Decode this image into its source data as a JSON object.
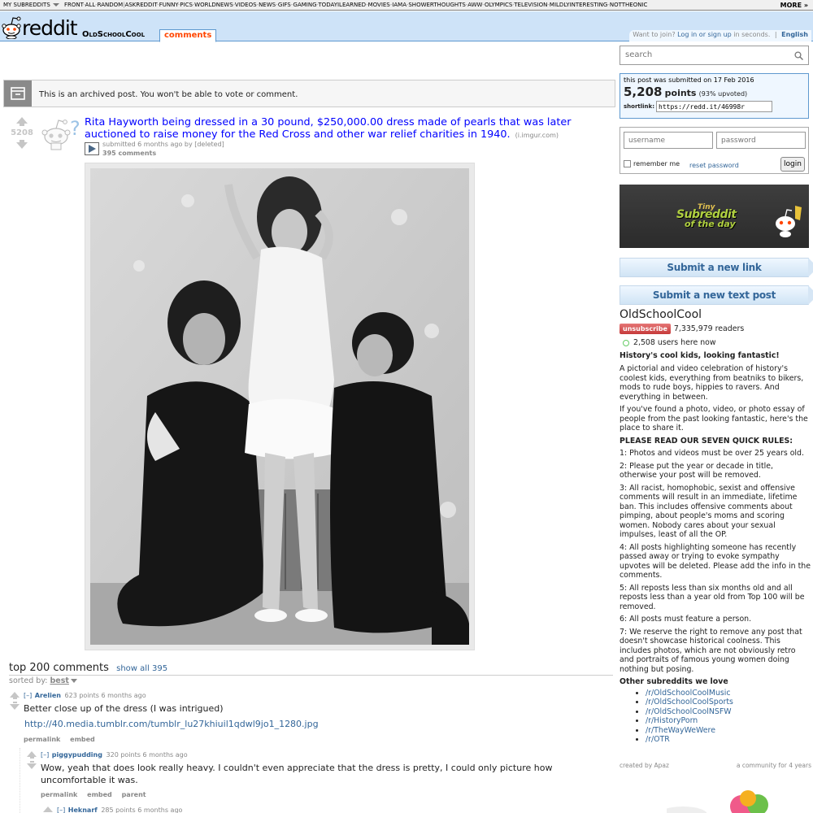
{
  "strip": {
    "my_subreddits": "MY SUBREDDITS",
    "links": [
      "FRONT",
      "ALL",
      "RANDOM",
      "ASKREDDIT",
      "FUNNY",
      "PICS",
      "WORLDNEWS",
      "VIDEOS",
      "NEWS",
      "GIFS",
      "GAMING",
      "TODAYILEARNED",
      "MOVIES",
      "IAMA",
      "SHOWERTHOUGHTS",
      "AWW",
      "OLYMPICS",
      "TELEVISION",
      "MILDLYINTERESTING",
      "NOTTHEONIC"
    ],
    "more": "MORE »"
  },
  "header": {
    "logo_text": "reddit",
    "subreddit": "OldSchoolCool",
    "active_tab": "comments",
    "join_text": "Want to join?",
    "login_link": "Log in or sign up",
    "join_suffix": "in seconds.",
    "language": "English"
  },
  "search": {
    "placeholder": "search"
  },
  "linkinfo": {
    "submitted": "this post was submitted on 17 Feb 2016",
    "points": "5,208",
    "points_label": "points",
    "upvoted": "(93% upvoted)",
    "shortlink_label": "shortlink:",
    "shortlink": "https://redd.it/46998r"
  },
  "login": {
    "username_placeholder": "username",
    "password_placeholder": "password",
    "remember": "remember me",
    "reset": "reset password",
    "button": "login"
  },
  "promo": {
    "line1": "Tiny",
    "line2": "Subreddit",
    "line3": "of the day"
  },
  "submit": {
    "link": "Submit a new link",
    "text": "Submit a new text post"
  },
  "sidebar": {
    "title": "OldSchoolCool",
    "unsubscribe": "unsubscribe",
    "readers": "7,335,979 readers",
    "online": "2,508 users here now",
    "tagline": "History's cool kids, looking fantastic!",
    "desc1": "A pictorial and video celebration of history's coolest kids, everything from beatniks to bikers, mods to rude boys, hippies to ravers. And everything in between.",
    "desc2": "If you've found a photo, video, or photo essay of people from the past looking fantastic, here's the place to share it.",
    "rules_title": "PLEASE READ OUR SEVEN QUICK RULES:",
    "rules": [
      "1: Photos and videos must be over 25 years old.",
      "2: Please put the year or decade in title, otherwise your post will be removed.",
      "3: All racist, homophobic, sexist and offensive comments will result in an immediate, lifetime ban. This includes offensive comments about pimping, about people's moms and scoring women. Nobody cares about your sexual impulses, least of all the OP.",
      "4: All posts highlighting someone has recently passed away or trying to evoke sympathy upvotes will be deleted. Please add the info in the comments.",
      "5: All reposts less than six months old and all reposts less than a year old from Top 100 will be removed.",
      "6: All posts must feature a person.",
      "7: We reserve the right to remove any post that doesn't showcase historical coolness. This includes photos, which are not obviously retro and portraits of famous young women doing nothing but posing."
    ],
    "other_title": "Other subreddits we love",
    "other": [
      "/r/OldSchoolCoolMusic",
      "/r/OldSchoolCoolSports",
      "/r/OldSchoolCoolNSFW",
      "/r/HistoryPorn",
      "/r/TheWayWeWere",
      "/r/OTR"
    ],
    "created_by": "created by Apaz",
    "community_age": "a community for 4 years"
  },
  "archived": {
    "text": "This is an archived post. You won't be able to vote or comment."
  },
  "post": {
    "score": "5208",
    "title": "Rita Hayworth being dressed in a 30 pound, $250,000.00 dress made of pearls that was later auctioned to raise money for the Red Cross and other war relief charities in 1940.",
    "domain": "(i.imgur.com)",
    "tagline": "submitted 6 months ago by [deleted]",
    "comments": "395 comments"
  },
  "comments_area": {
    "title": "top 200 comments",
    "show_all": "show all 395",
    "sorted_by": "sorted by:",
    "sort_value": "best"
  },
  "comments": [
    {
      "toggle": "[–]",
      "author": "Arelien",
      "meta": "623 points 6 months ago",
      "text": "Better close up of the dress (I was intrigued)",
      "link": "http://40.media.tumblr.com/tumblr_lu27khiuil1qdwl9jo1_1280.jpg",
      "actions": [
        "permalink",
        "embed"
      ]
    },
    {
      "toggle": "[–]",
      "author": "piggypudding",
      "meta": "320 points 6 months ago",
      "text": "Wow, yeah that does look really heavy. I couldn't even appreciate that the dress is pretty, I could only picture how uncomfortable it was.",
      "actions": [
        "permalink",
        "embed",
        "parent"
      ]
    },
    {
      "toggle": "[–]",
      "author": "Heknarf",
      "meta": "285 points 6 months ago"
    }
  ],
  "colors": {
    "link": "#0000ff",
    "accent": "#ff4500",
    "header_bg": "#cee3f8",
    "meta_link": "#369"
  }
}
